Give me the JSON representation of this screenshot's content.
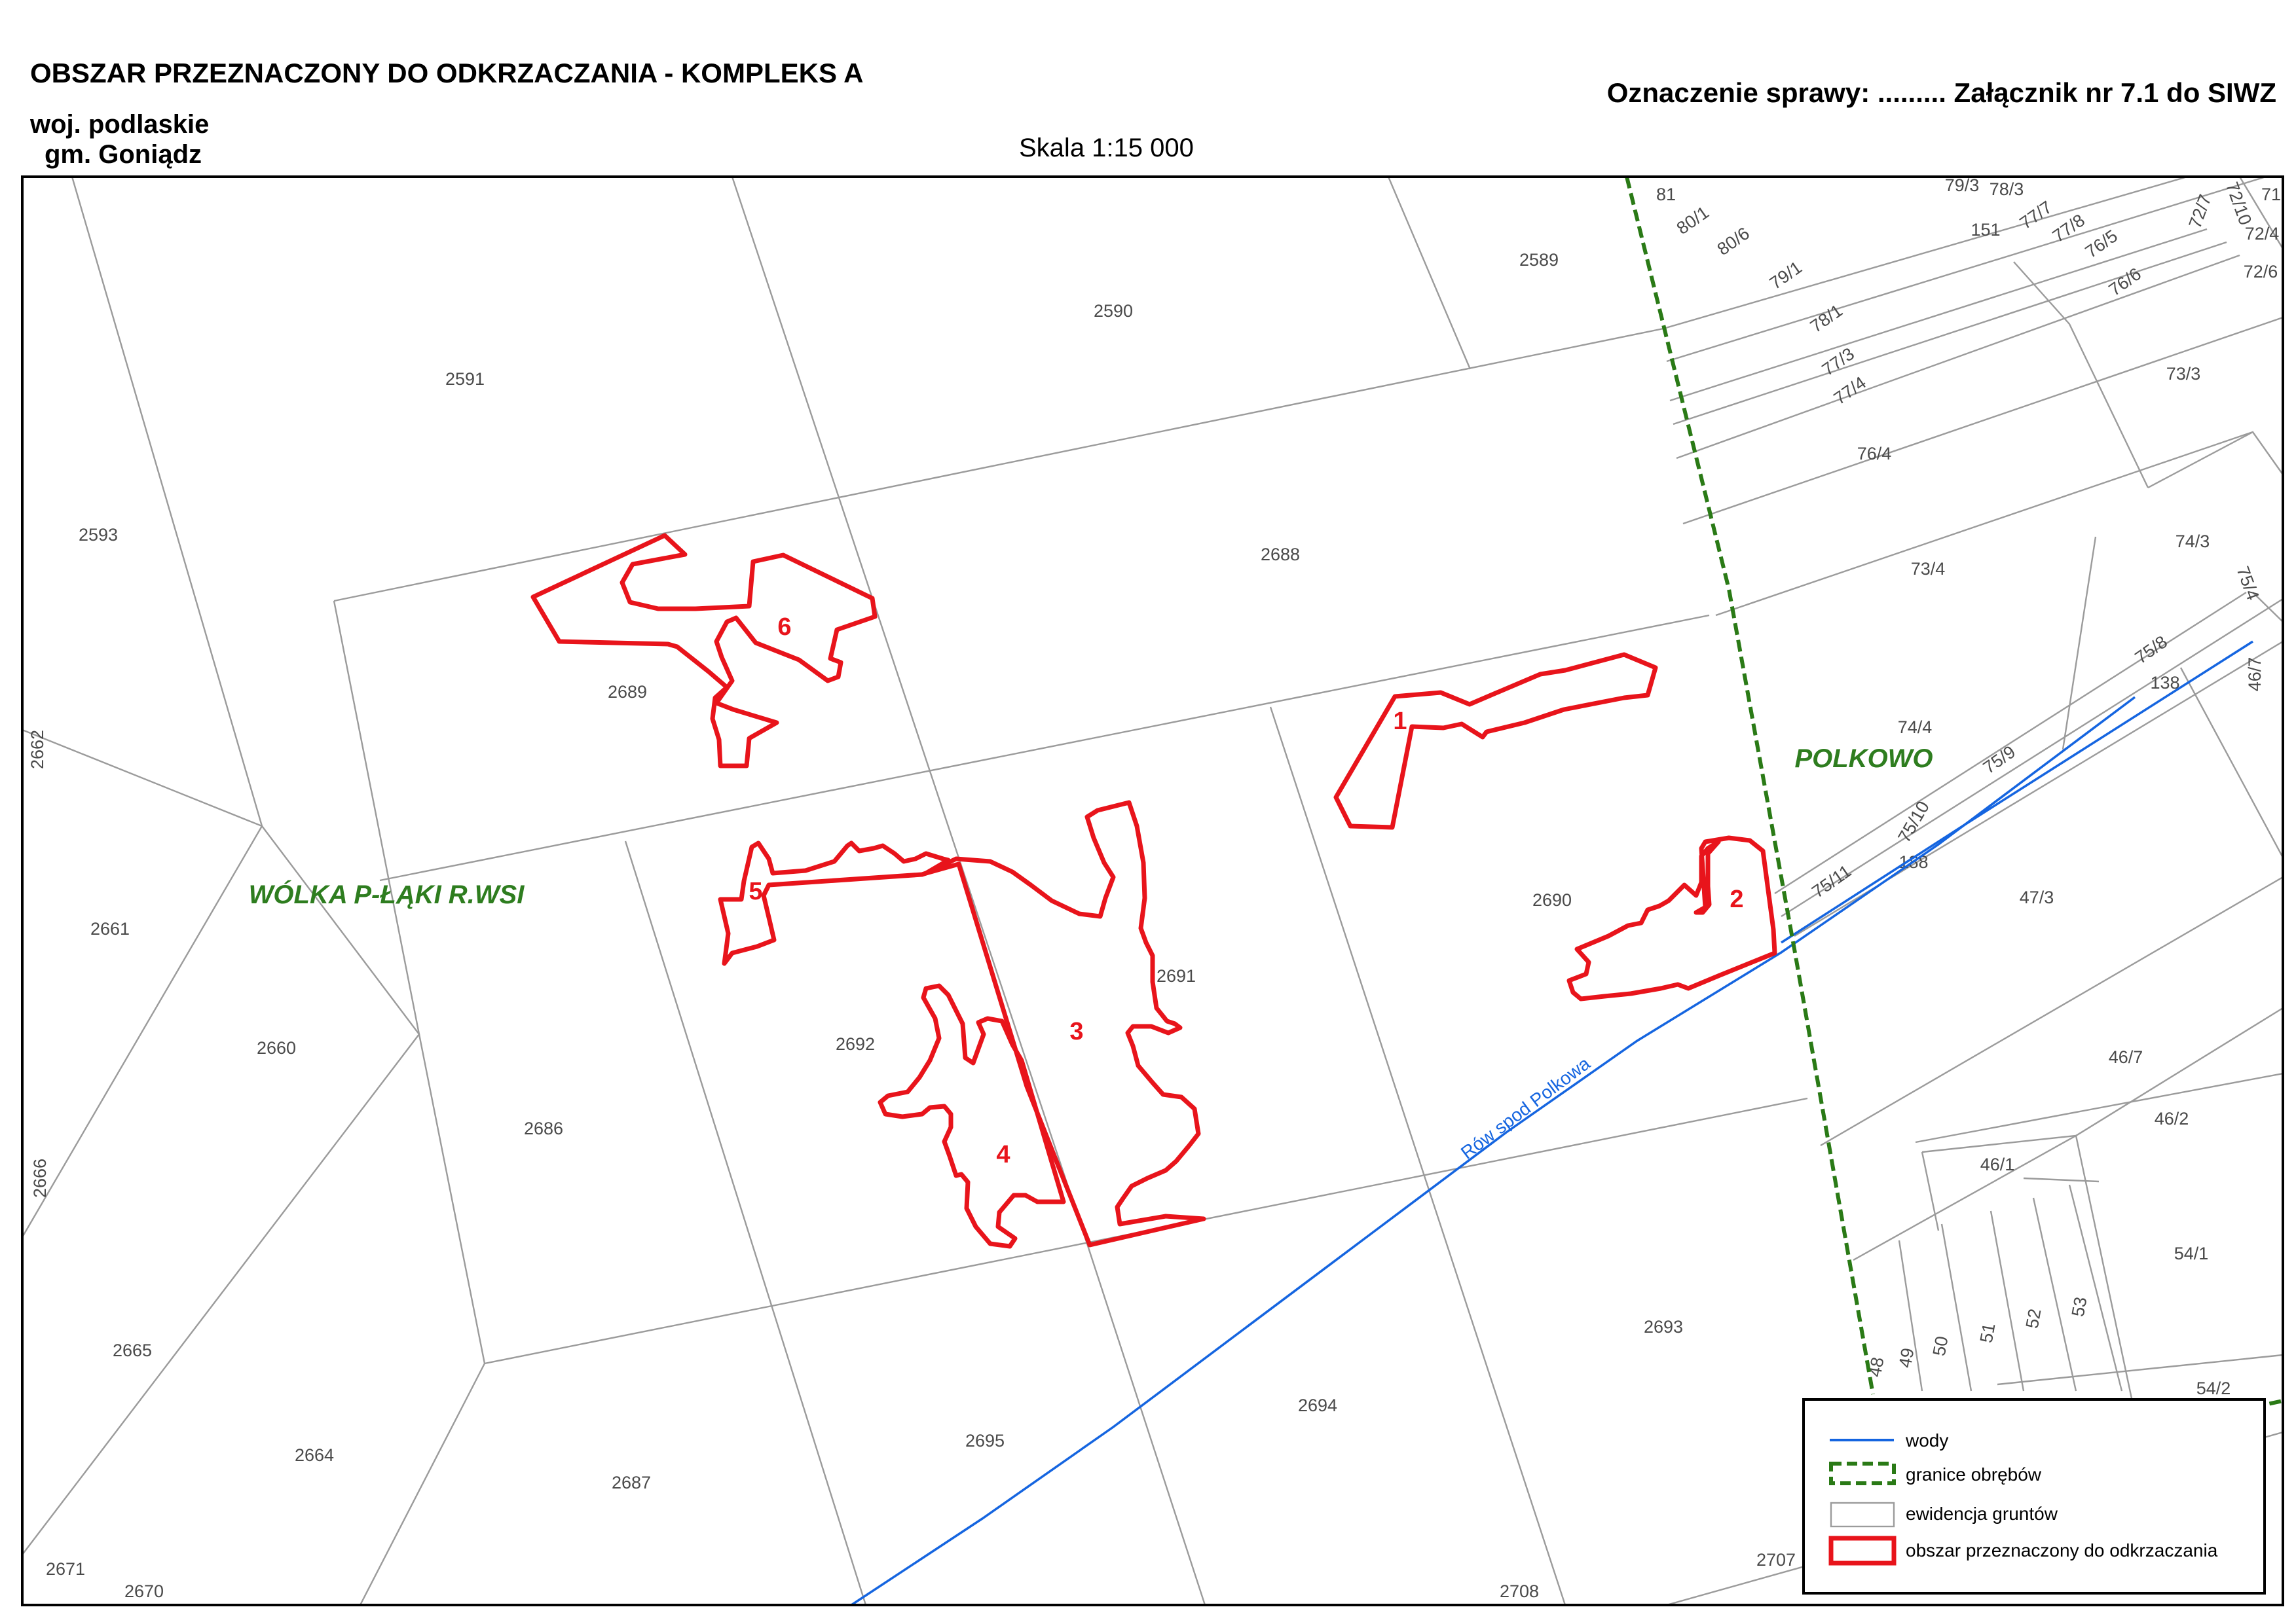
{
  "header": {
    "title": "OBSZAR PRZEZNACZONY DO ODKRZACZANIA - KOMPLEKS A",
    "case_ref": "Oznaczenie sprawy: ......... Załącznik nr 7.1  do SIWZ",
    "province": "woj. podlaskie",
    "municipality": "gm. Goniądz",
    "scale": "Skala 1:15 000"
  },
  "villages": [
    "WÓLKA P-ŁĄKI R.WSI",
    "POLKOWO"
  ],
  "water_label": "Rów spod Polkowa",
  "areas": [
    "1",
    "2",
    "3",
    "4",
    "5",
    "6"
  ],
  "parcels": {
    "p2589": "2589",
    "p2590": "2590",
    "p2591": "2591",
    "p2593": "2593",
    "p2688": "2688",
    "p2689": "2689",
    "p2662": "2662",
    "p2661": "2661",
    "p2660": "2660",
    "p2686": "2686",
    "p2692": "2692",
    "p2691": "2691",
    "p2690": "2690",
    "p2666": "2666",
    "p2665": "2665",
    "p2664": "2664",
    "p2687": "2687",
    "p2695": "2695",
    "p2694": "2694",
    "p2693": "2693",
    "p2671": "2671",
    "p2670": "2670",
    "p2708": "2708",
    "p2707": "2707",
    "p81": "81",
    "p80_1": "80/1",
    "p80_6": "80/6",
    "p79_3": "79/3",
    "p78_3": "78/3",
    "p151": "151",
    "p77_7": "77/7",
    "p77_8": "77/8",
    "p76_5": "76/5",
    "p72_7": "72/7",
    "p72_10": "72/10",
    "p71": "71",
    "p72_4": "72/4",
    "p72_6": "72/6",
    "p79_1": "79/1",
    "p78_1": "78/1",
    "p77_3": "77/3",
    "p77_4": "77/4",
    "p76_6": "76/6",
    "p73_3": "73/3",
    "p76_4": "76/4",
    "p73_4": "73/4",
    "p74_3": "74/3",
    "p75_4": "75/4",
    "p75_8": "75/8",
    "p138": "138",
    "p46_7a": "46/7",
    "p74_4": "74/4",
    "p75_9": "75/9",
    "p75_10": "75/10",
    "p188": "188",
    "p75_11": "75/11",
    "p47_3": "47/3",
    "p46_7b": "46/7",
    "p46_2": "46/2",
    "p46_1": "46/1",
    "p54_1": "54/1",
    "p48": "48",
    "p49": "49",
    "p50": "50",
    "p51": "51",
    "p52": "52",
    "p53": "53",
    "p54_2": "54/2"
  },
  "legend": {
    "water": "wody",
    "boundary": "granice obrębów",
    "parcels": "ewidencja gruntów",
    "clearing": "obszar przeznaczony do odkrzaczania"
  },
  "colors": {
    "clearing_area": "#e8141b",
    "water": "#1565e0",
    "boundary": "#2a7a16",
    "parcel_lines": "#9b9b9b",
    "village_label": "#2e7d1f"
  }
}
